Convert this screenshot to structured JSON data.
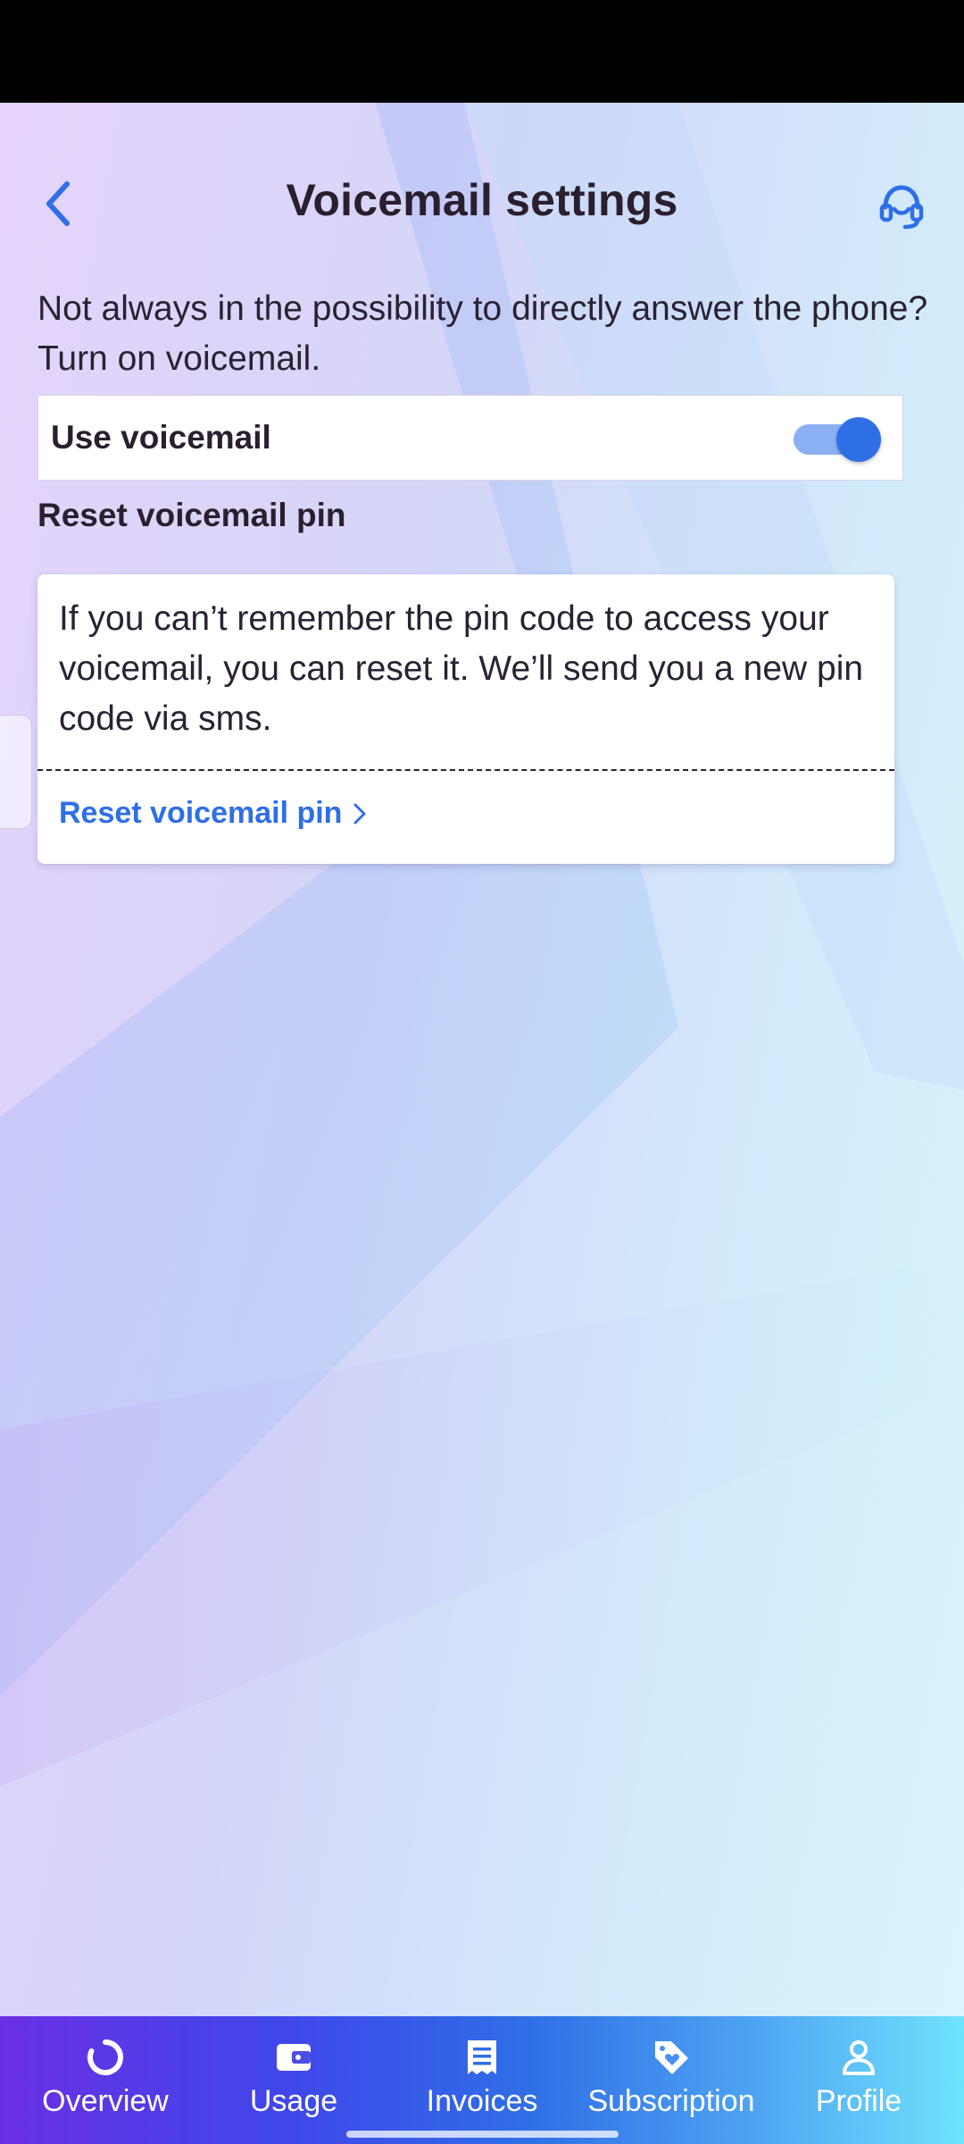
{
  "header": {
    "title": "Voicemail settings",
    "back_icon": "chevron-left-icon",
    "support_icon": "headset-icon"
  },
  "intro_text": "Not always in the possibility to directly answer the phone? Turn on voicemail.",
  "voicemail_toggle": {
    "label": "Use voicemail",
    "enabled": true
  },
  "reset_section": {
    "heading": "Reset voicemail pin",
    "description": "If you can’t remember the pin code to access your voicemail, you can reset it. We’ll send you a new pin code via sms.",
    "link_label": "Reset voicemail pin",
    "link_icon": "chevron-right-icon"
  },
  "bottom_nav": {
    "items": [
      {
        "label": "Overview",
        "icon": "overview-ring-icon"
      },
      {
        "label": "Usage",
        "icon": "wallet-icon"
      },
      {
        "label": "Invoices",
        "icon": "invoice-icon"
      },
      {
        "label": "Subscription",
        "icon": "tag-heart-icon"
      },
      {
        "label": "Profile",
        "icon": "person-icon"
      }
    ]
  },
  "colors": {
    "accent": "#2f6fe6",
    "toggle_track": "#8ab0f3",
    "title_text": "#2a1f2e",
    "nav_gradient_start": "#6a2fe4",
    "nav_gradient_end": "#6fe3fb"
  }
}
